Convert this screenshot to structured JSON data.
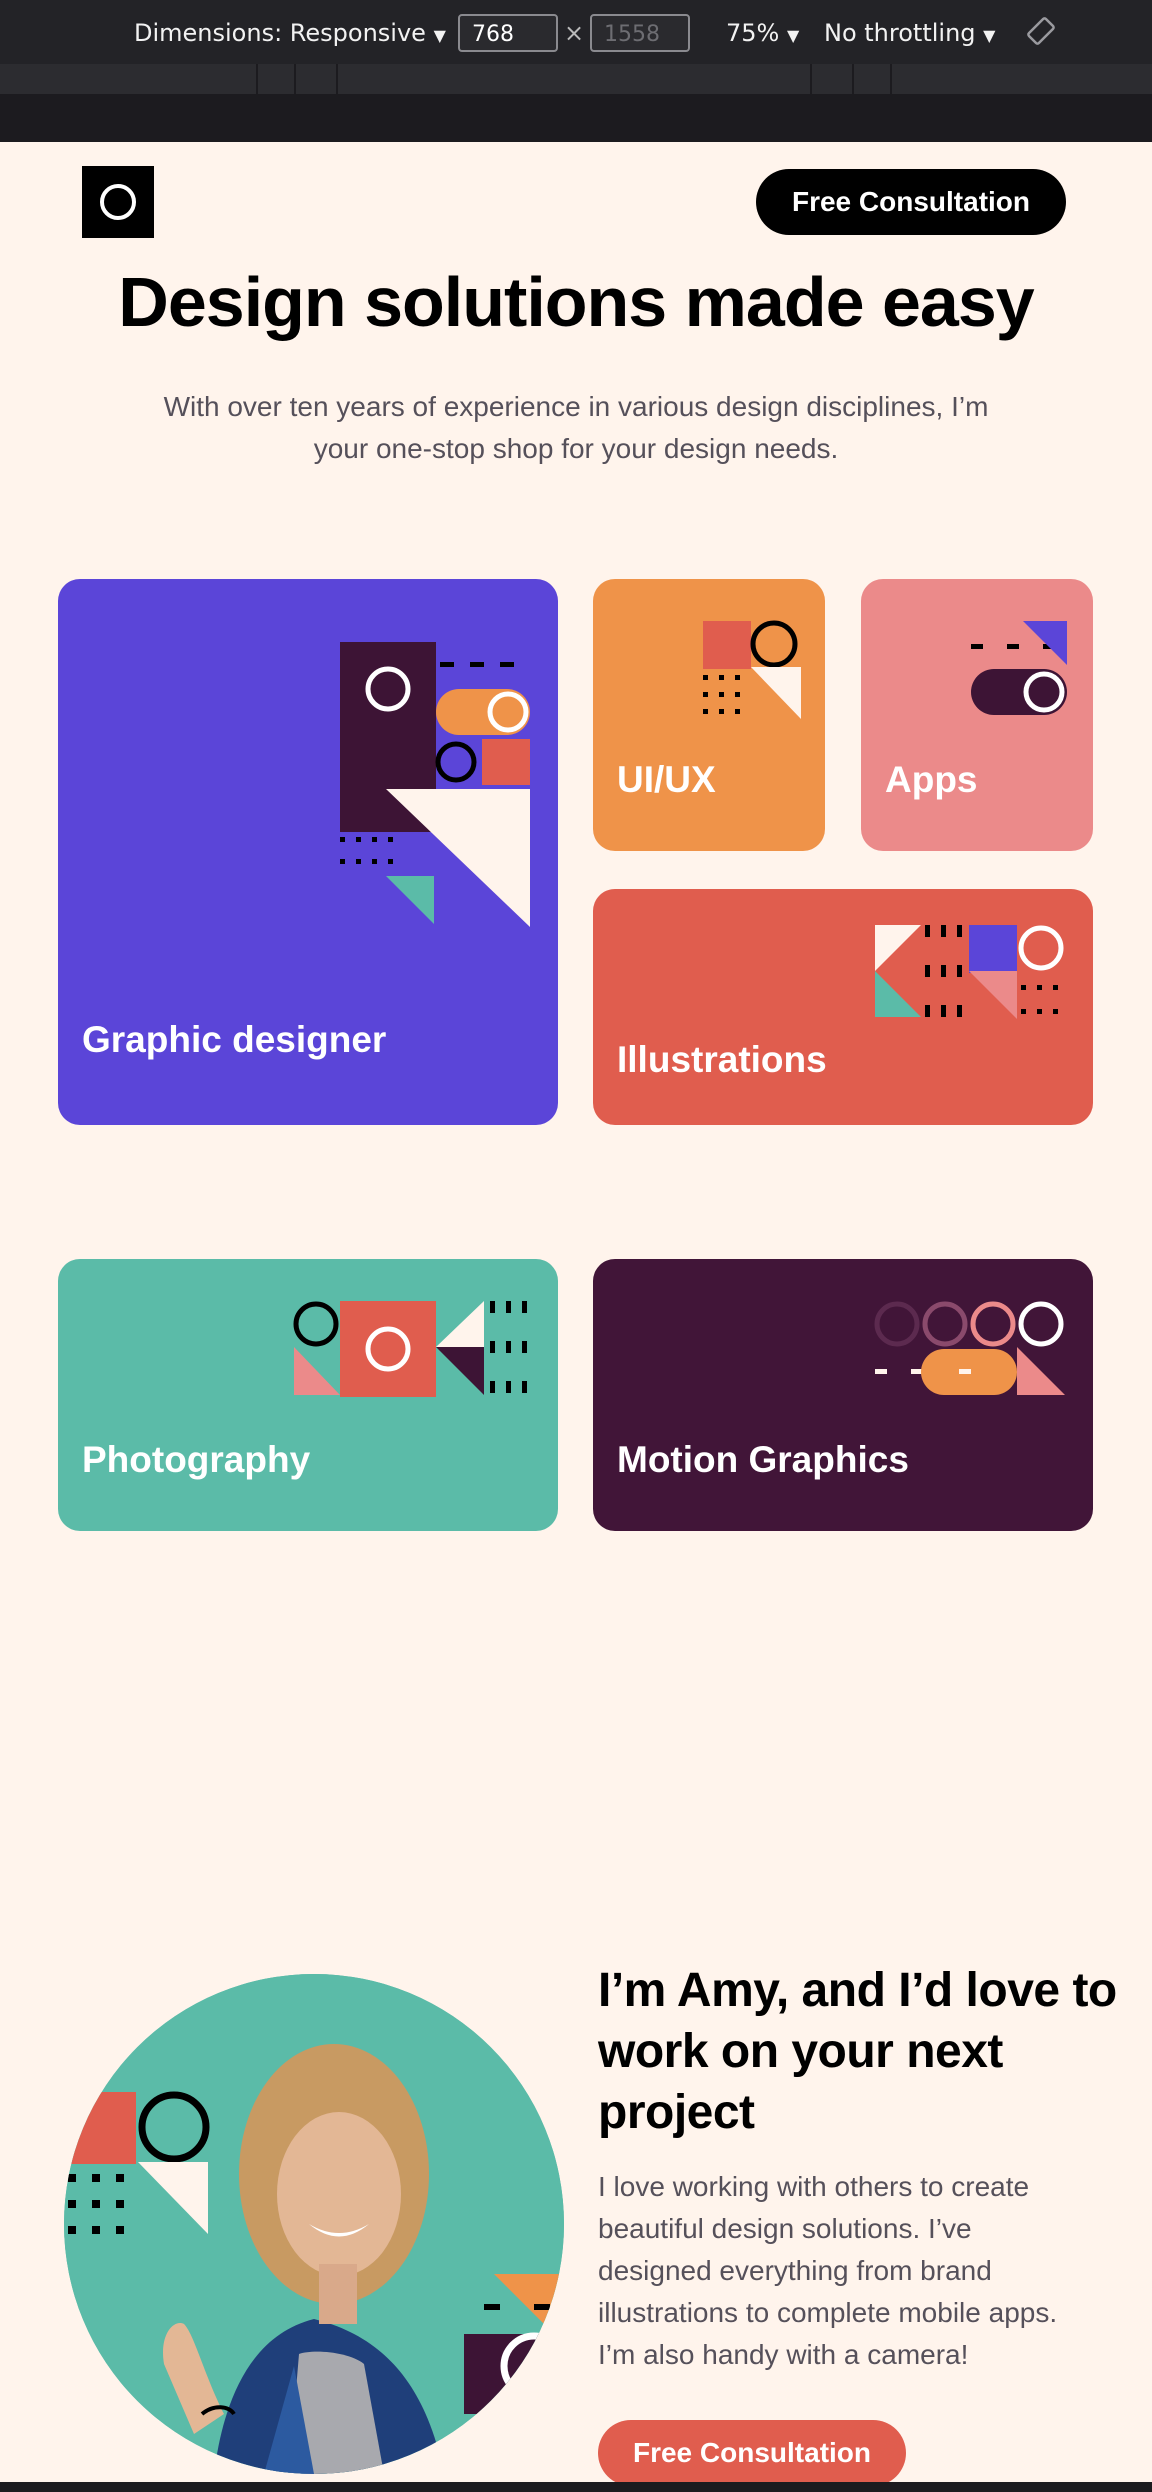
{
  "devtools": {
    "dimensions_label": "Dimensions: Responsive",
    "width_value": "768",
    "times_sign": "×",
    "height_placeholder": "1558",
    "zoom_label": "75%",
    "throttle_label": "No throttling",
    "dropdown_arrow": "▼"
  },
  "header": {
    "cta_label": "Free Consultation"
  },
  "hero": {
    "title": "Design solutions made easy",
    "subtitle": "With over ten years of experience in various design disciplines, I’m your one-stop shop for your design needs."
  },
  "services": [
    {
      "label": "Graphic designer",
      "color": "#5b45d8"
    },
    {
      "label": "UI/UX",
      "color": "#ef9349"
    },
    {
      "label": "Apps",
      "color": "#eb8a8a"
    },
    {
      "label": "Illustrations",
      "color": "#e05d4e"
    },
    {
      "label": "Photography",
      "color": "#5bbba8"
    },
    {
      "label": "Motion Graphics",
      "color": "#411538"
    }
  ],
  "about": {
    "title": "I’m Amy, and I’d love to work on your next project",
    "text": "I love working with others to create beautiful design solutions. I’ve designed everything from brand illustrations to complete mobile apps. I’m also handy with a camera!",
    "cta_label": "Free Consultation"
  },
  "colors": {
    "page_bg": "#fff4ec",
    "dark_plum": "#3d1435",
    "accent_red": "#e05d4e",
    "orange": "#ef9349",
    "pink": "#eb8a8a",
    "teal": "#5bbba8",
    "purple": "#5b45d8"
  }
}
